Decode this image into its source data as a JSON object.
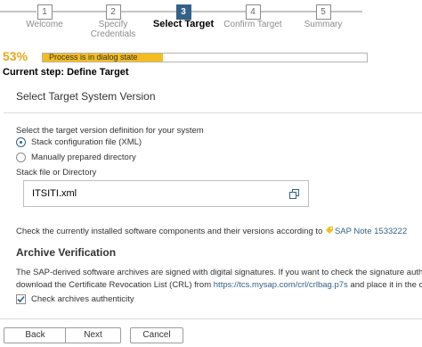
{
  "roadmap": {
    "steps": [
      {
        "number": "1",
        "label": "Welcome",
        "active": false
      },
      {
        "number": "2",
        "label": "Specify Credentials",
        "active": false
      },
      {
        "number": "3",
        "label": "Select Target",
        "active": true
      },
      {
        "number": "4",
        "label": "Confirm Target",
        "active": false
      },
      {
        "number": "5",
        "label": "Summary",
        "active": false
      }
    ]
  },
  "progress": {
    "percent_label": "53%",
    "fraction": 0.53,
    "status_text": "Process is in dialog state"
  },
  "current_step": "Current step: Define Target",
  "panel": {
    "title": "Select Target System Version"
  },
  "form": {
    "prompt": "Select the target version definition for your system",
    "options": [
      {
        "label": "Stack configuration file (XML)",
        "selected": true
      },
      {
        "label": "Manually prepared directory",
        "selected": false
      }
    ],
    "file_label": "Stack file or Directory",
    "file_value": "ITSITI.xml",
    "check_text": "Check the currently installed software components and their versions according to",
    "note_link": "SAP Note 1533222"
  },
  "archive": {
    "heading": "Archive Verification",
    "line1": "The SAP-derived software archives are signed with digital signatures. If you want to check the signature auth",
    "line2_prefix": "download the Certificate Revocation List (CRL) from",
    "crl_link": "https://tcs.mysap.com/crl/crlbag.p7s",
    "line2_suffix": "and place it in the c",
    "checkbox_label": "Check archives authenticity",
    "checkbox_checked": true
  },
  "buttons": {
    "back": "Back",
    "next": "Next",
    "cancel": "Cancel"
  },
  "colors": {
    "accent": "#346187",
    "progress": "#f4bd1f",
    "percent": "#e8a617",
    "link": "#346187"
  }
}
